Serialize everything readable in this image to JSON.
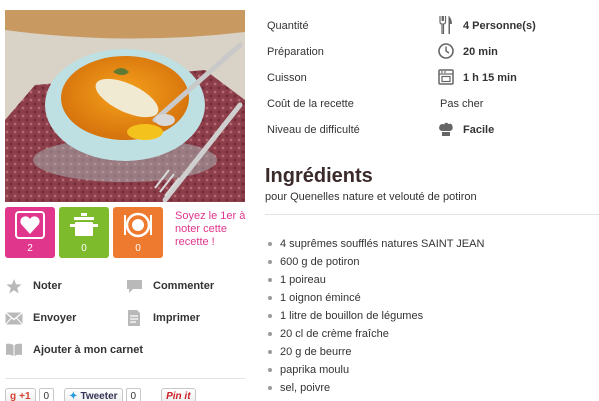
{
  "recipe_info": {
    "rows": [
      {
        "label": "Quantité",
        "icon": "cutlery-icon",
        "value": "4 Personne(s)"
      },
      {
        "label": "Préparation",
        "icon": "clock-icon",
        "value": "20 min"
      },
      {
        "label": "Cuisson",
        "icon": "oven-icon",
        "value": "1 h 15 min"
      },
      {
        "label": "Coût de la recette",
        "icon": "",
        "value": "Pas cher"
      },
      {
        "label": "Niveau de difficulté",
        "icon": "chef-hat-icon",
        "value": "Facile"
      }
    ]
  },
  "ingredients": {
    "title": "Ingrédients",
    "subtitle": "pour Quenelles nature et velouté de potiron",
    "items": [
      "4 suprêmes soufflés natures SAINT JEAN",
      "600 g de potiron",
      "1 poireau",
      "1 oignon émincé",
      "1 litre de bouillon de légumes",
      "20 cl de crème fraîche",
      "20 g de beurre",
      "paprika moulu",
      "sel, poivre"
    ]
  },
  "stats": {
    "likes": {
      "count": "2",
      "icon": "heart-icon",
      "color": "#e0368c"
    },
    "cooked": {
      "count": "0",
      "icon": "pot-icon",
      "color": "#7dbb2c"
    },
    "eaten": {
      "count": "0",
      "icon": "plate-icon",
      "color": "#ee7a2f"
    },
    "prompt": "Soyez le 1er à noter cette recette !"
  },
  "actions": {
    "rate": "Noter",
    "comment": "Commenter",
    "send": "Envoyer",
    "print": "Imprimer",
    "add_to_notebook": "Ajouter à mon carnet"
  },
  "share": {
    "gplus_label": "+1",
    "gplus_count": "0",
    "tweet_label": "Tweeter",
    "tweet_count": "0",
    "pinterest_label": "Pin it"
  },
  "colors": {
    "accent_pink": "#e0368c",
    "accent_green": "#7dbb2c",
    "accent_orange": "#ee7a2f"
  }
}
